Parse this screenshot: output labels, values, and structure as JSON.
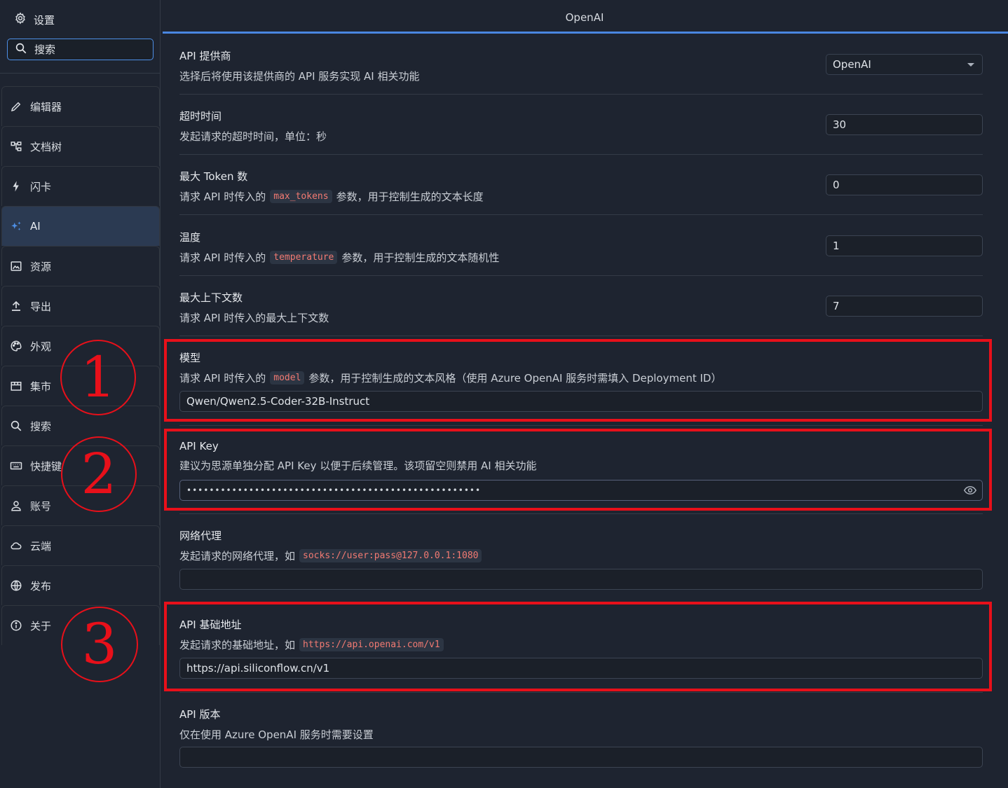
{
  "sidebar": {
    "title": "设置",
    "search_placeholder": "搜索",
    "items": [
      {
        "label": "编辑器",
        "icon": "pencil-icon"
      },
      {
        "label": "文档树",
        "icon": "tree-icon"
      },
      {
        "label": "闪卡",
        "icon": "flash-icon"
      },
      {
        "label": "AI",
        "icon": "sparkle-icon",
        "active": true
      },
      {
        "label": "资源",
        "icon": "image-icon"
      },
      {
        "label": "导出",
        "icon": "upload-icon"
      },
      {
        "label": "外观",
        "icon": "palette-icon"
      },
      {
        "label": "集市",
        "icon": "store-icon"
      },
      {
        "label": "搜索",
        "icon": "search-icon"
      },
      {
        "label": "快捷键",
        "icon": "keyboard-icon"
      },
      {
        "label": "账号",
        "icon": "user-icon"
      },
      {
        "label": "云端",
        "icon": "cloud-icon"
      },
      {
        "label": "发布",
        "icon": "globe-icon"
      },
      {
        "label": "关于",
        "icon": "info-icon"
      }
    ]
  },
  "main": {
    "tab_title": "OpenAI",
    "settings": {
      "provider": {
        "name": "API 提供商",
        "desc": "选择后将使用该提供商的 API 服务实现 AI 相关功能",
        "value": "OpenAI"
      },
      "timeout": {
        "name": "超时时间",
        "desc": "发起请求的超时时间，单位：秒",
        "value": "30"
      },
      "max_tokens": {
        "name": "最大 Token 数",
        "desc_pre": "请求 API 时传入的",
        "code": "max_tokens",
        "desc_post": "参数，用于控制生成的文本长度",
        "value": "0"
      },
      "temperature": {
        "name": "温度",
        "desc_pre": "请求 API 时传入的",
        "code": "temperature",
        "desc_post": "参数，用于控制生成的文本随机性",
        "value": "1"
      },
      "max_context": {
        "name": "最大上下文数",
        "desc": "请求 API 时传入的最大上下文数",
        "value": "7"
      },
      "model": {
        "name": "模型",
        "desc_pre": "请求 API 时传入的",
        "code": "model",
        "desc_post": "参数，用于控制生成的文本风格（使用 Azure OpenAI 服务时需填入 Deployment ID）",
        "value": "Qwen/Qwen2.5-Coder-32B-Instruct"
      },
      "api_key": {
        "name": "API Key",
        "desc": "建议为思源单独分配 API Key 以便于后续管理。该项留空则禁用 AI 相关功能",
        "value": "••••••••••••••••••••••••••••••••••••••••••••••••••••"
      },
      "proxy": {
        "name": "网络代理",
        "desc_pre": "发起请求的网络代理，如",
        "code": "socks://user:pass@127.0.0.1:1080",
        "value": ""
      },
      "base_url": {
        "name": "API 基础地址",
        "desc_pre": "发起请求的基础地址，如",
        "code": "https://api.openai.com/v1",
        "value": "https://api.siliconflow.cn/v1"
      },
      "api_version": {
        "name": "API 版本",
        "desc": "仅在使用 Azure OpenAI 服务时需要设置",
        "value": ""
      }
    }
  },
  "annotations": {
    "marker1": "1",
    "marker2": "2",
    "marker3": "3",
    "color": "#e8101a"
  }
}
